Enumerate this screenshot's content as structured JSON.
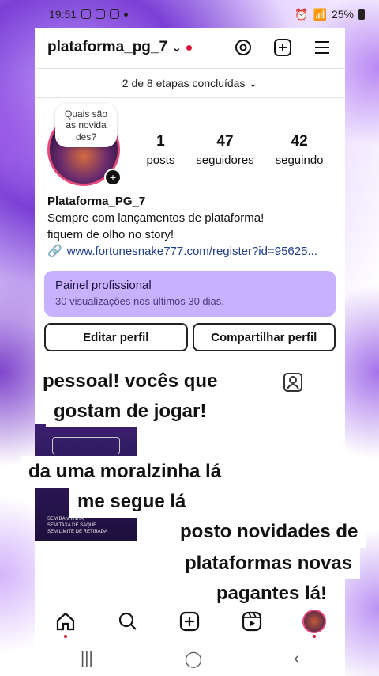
{
  "status_bar": {
    "time": "19:51",
    "battery": "25%"
  },
  "header": {
    "username": "plataforma_pg_7",
    "chevron": "⌄"
  },
  "setup": {
    "steps_text": "2 de 8 etapas concluídas"
  },
  "profile": {
    "note": "Quais são as novida des?",
    "stats": [
      {
        "num": "1",
        "label": "posts"
      },
      {
        "num": "47",
        "label": "seguidores"
      },
      {
        "num": "42",
        "label": "seguindo"
      }
    ],
    "name": "Plataforma_PG_7",
    "bio_lines": [
      "Sempre com lançamentos de plataforma!",
      "fiquem de olho no story!"
    ],
    "link": "www.fortunesnake777.com/register?id=95625..."
  },
  "pro_panel": {
    "title": "Painel profissional",
    "subtitle": "30 visualizações nos últimos 30 dias."
  },
  "buttons": {
    "edit": "Editar perfil",
    "share": "Compartilhar perfil"
  },
  "thumbnail": {
    "lines": [
      "SEM BANHINHA",
      "SEM TAXA DE SAQUE",
      "SEM LIMITE DE RETIRADA"
    ]
  },
  "captions": {
    "c1_line1": "pessoal! vocês que",
    "c1_line2": "gostam de jogar!",
    "c2_line1": "da uma moralzinha lá",
    "c2_line2": "me segue lá",
    "c3_line1": "posto novidades de",
    "c3_line2": "plataformas novas",
    "c3_line3": "pagantes lá!"
  },
  "icons": {
    "threads": "threads-icon",
    "create": "plus-square-icon",
    "menu": "hamburger-menu-icon",
    "home": "home-icon",
    "search": "search-icon",
    "reels": "reels-icon",
    "tagged": "tagged-person-icon"
  },
  "colors": {
    "accent_red": "#e0163b",
    "panel_purple": "#c9b1ff",
    "link_blue": "#1f3c88"
  }
}
